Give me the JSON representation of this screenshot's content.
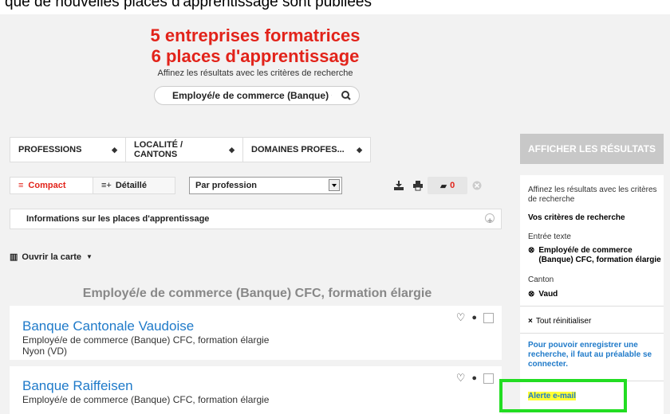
{
  "banner": {
    "text": "que de nouvelles places d'apprentissage sont publiées"
  },
  "hero": {
    "line1": "5 entreprises formatrices",
    "line2": "6 places d'apprentissage",
    "subtitle": "Affinez les résultats avec les critères de recherche"
  },
  "search": {
    "value": "Employé/e de commerce (Banque) CF(",
    "icon": "search-icon"
  },
  "filters": [
    {
      "label": "PROFESSIONS"
    },
    {
      "label": "LOCALITÉ / CANTONS"
    },
    {
      "label": "DOMAINES PROFES..."
    }
  ],
  "show_results_label": "AFFICHER LES RÉSULTATS",
  "view": {
    "compact_label": "Compact",
    "detailed_label": "Détaillé",
    "sort_value": "Par profession"
  },
  "tools": {
    "cart_count": "0"
  },
  "info_bar_label": "Informations sur les places d'apprentissage",
  "open_map_label": "Ouvrir la carte",
  "section_title": "Employé/e de commerce (Banque) CFC, formation élargie",
  "results": [
    {
      "name": "Banque Cantonale Vaudoise",
      "profession": "Employé/e de commerce (Banque) CFC, formation élargie",
      "location": "Nyon (VD)"
    },
    {
      "name": "Banque Raiffeisen",
      "profession": "Employé/e de commerce (Banque) CFC, formation élargie"
    }
  ],
  "sidebar": {
    "intro": "Affinez les résultats avec les critères de recherche",
    "criteria_title": "Vos critères de recherche",
    "text_entry_label": "Entrée texte",
    "text_entry_value": "Employé/e de commerce (Banque) CFC, formation élargie",
    "canton_label": "Canton",
    "canton_value": "Vaud",
    "reset_label": "Tout réinitialiser",
    "login_note": "Pour pouvoir enregistrer une recherche, il faut au préalable se connecter.",
    "alert_label": "Alerte e-mail"
  },
  "colors": {
    "brand_red": "#e2231a",
    "link_blue": "#1f7ac9",
    "highlight_yellow": "#ffff33",
    "highlight_green": "#22dd22"
  }
}
